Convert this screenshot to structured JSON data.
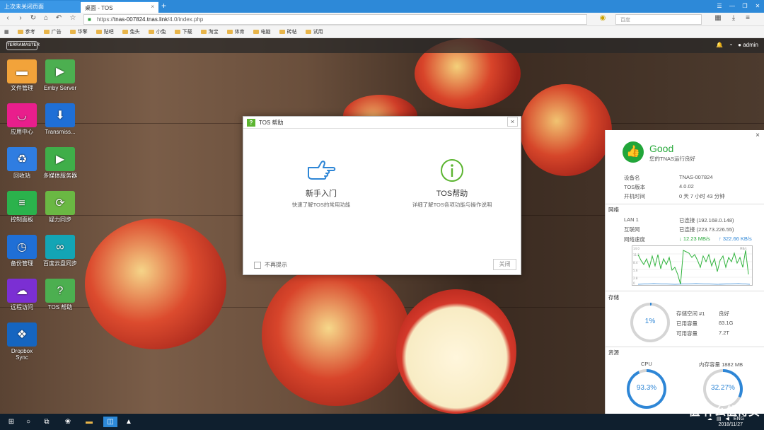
{
  "browser": {
    "tabs": [
      "上次未关闭页面",
      "桌面 - TOS"
    ],
    "new_tab": "+",
    "url_prefix": "https://",
    "url_host": "tnas-007824.tnas.link",
    "url_path": "/4.0/index.php",
    "search_placeholder": "百度",
    "bookmarks": [
      "参考",
      "广告",
      "华擎",
      "贴吧",
      "兔头",
      "小兔",
      "下载",
      "淘宝",
      "体育",
      "电脑",
      "砖帖",
      "试用"
    ]
  },
  "desktop": {
    "logo": "TERRAMASTER",
    "user": "admin",
    "icons": [
      {
        "label": "文件管理",
        "color": "#f2a33a",
        "glyph": "▬"
      },
      {
        "label": "Emby Server",
        "color": "#4caf50",
        "glyph": "▶"
      },
      {
        "label": "应用中心",
        "color": "#e91e8c",
        "glyph": "◡"
      },
      {
        "label": "Transmiss...",
        "color": "#1f6fd6",
        "glyph": "⬇"
      },
      {
        "label": "回收站",
        "color": "#2f7de1",
        "glyph": "♻"
      },
      {
        "label": "多媒体服务器",
        "color": "#3fae49",
        "glyph": "▶"
      },
      {
        "label": "控制面板",
        "color": "#2bb24c",
        "glyph": "≡"
      },
      {
        "label": "疑力同步",
        "color": "#6ab843",
        "glyph": "⟳"
      },
      {
        "label": "备份管理",
        "color": "#1f6fd6",
        "glyph": "◷"
      },
      {
        "label": "百度云盘同步",
        "color": "#13a5b5",
        "glyph": "∞"
      },
      {
        "label": "远程访问",
        "color": "#7b2fd3",
        "glyph": "☁"
      },
      {
        "label": "TOS 帮助",
        "color": "#4caf50",
        "glyph": "?"
      },
      {
        "label": "Dropbox Sync",
        "color": "#1565c0",
        "glyph": "❖"
      }
    ]
  },
  "dialog": {
    "title": "TOS 帮助",
    "title_icon": "?",
    "close": "×",
    "options": [
      {
        "title": "新手入门",
        "desc": "快速了解TOS的常用功能",
        "icon": "hand-pointer-icon"
      },
      {
        "title": "TOS帮助",
        "desc": "详细了解TOS各项功能与操作说明",
        "icon": "info-icon"
      }
    ],
    "checkbox_label": "不再提示",
    "close_button": "关闭"
  },
  "status": {
    "good": "Good",
    "good_sub": "您的TNAS运行良好",
    "close": "×",
    "device_rows": [
      {
        "label": "设备名",
        "value": "TNAS-007824"
      },
      {
        "label": "TOS版本",
        "value": "4.0.02"
      },
      {
        "label": "开机时间",
        "value": "0 天 7 小时 43 分钟"
      }
    ],
    "network_title": "网络",
    "network_rows": [
      {
        "label": "LAN 1",
        "value": "已连接 (192.168.0.148)"
      },
      {
        "label": "互联网",
        "value": "已连接 (223.73.226.55)"
      }
    ],
    "speed_label": "网络速度",
    "speed_down": "12.23 MB/s",
    "speed_up": "322.66 KB/s",
    "graph_unit": "MB/s",
    "graph_ticks": [
      "14.0",
      "11.2",
      "8.4",
      "5.6",
      "2.8",
      "0"
    ],
    "storage_title": "存储",
    "storage_percent": "1%",
    "storage_fraction": 0.01,
    "storage_rows": [
      {
        "label": "存储空间 #1",
        "value": "良好"
      },
      {
        "label": "已用容量",
        "value": "83.1G"
      },
      {
        "label": "可用容量",
        "value": "7.2T"
      }
    ],
    "resource_title": "资源",
    "cpu_label": "CPU",
    "cpu_value": "93.3%",
    "cpu_fraction": 0.933,
    "mem_label": "内存容量 1882 MB",
    "mem_value": "32.27%",
    "mem_fraction": 0.3227
  },
  "taskbar": {
    "ime": "ENG",
    "date": "2018/11/27",
    "watermark": "值 什么值得买"
  }
}
